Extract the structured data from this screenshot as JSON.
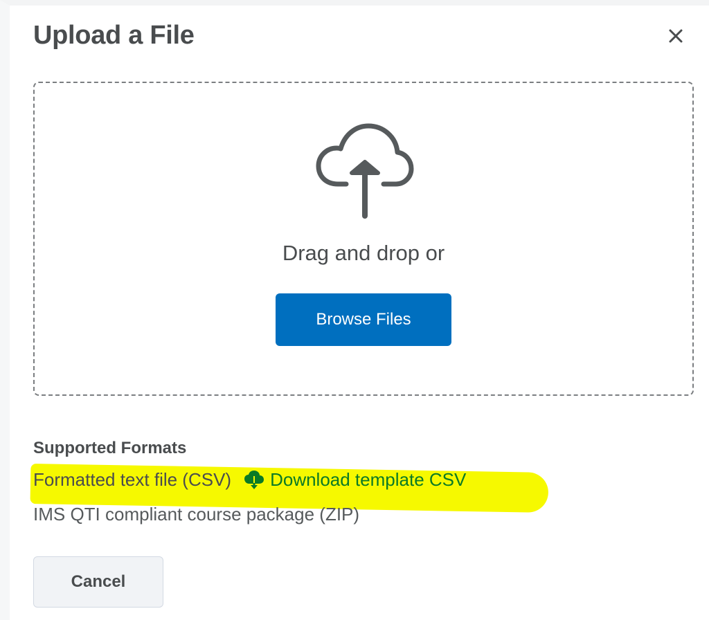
{
  "dialog": {
    "title": "Upload a File",
    "close_icon": "close-icon"
  },
  "dropzone": {
    "icon": "cloud-upload-icon",
    "drag_text": "Drag and drop or",
    "browse_label": "Browse Files"
  },
  "formats": {
    "heading": "Supported Formats",
    "items": [
      {
        "label": "Formatted text file (CSV)",
        "link_icon": "cloud-download-icon",
        "link_label": "Download template CSV",
        "highlighted": true
      },
      {
        "label": "IMS QTI compliant course package (ZIP)"
      }
    ]
  },
  "footer": {
    "cancel_label": "Cancel"
  },
  "colors": {
    "primary_button": "#006fbf",
    "link": "#0a7a26",
    "highlight": "#f6f900",
    "text": "#494c4e"
  }
}
